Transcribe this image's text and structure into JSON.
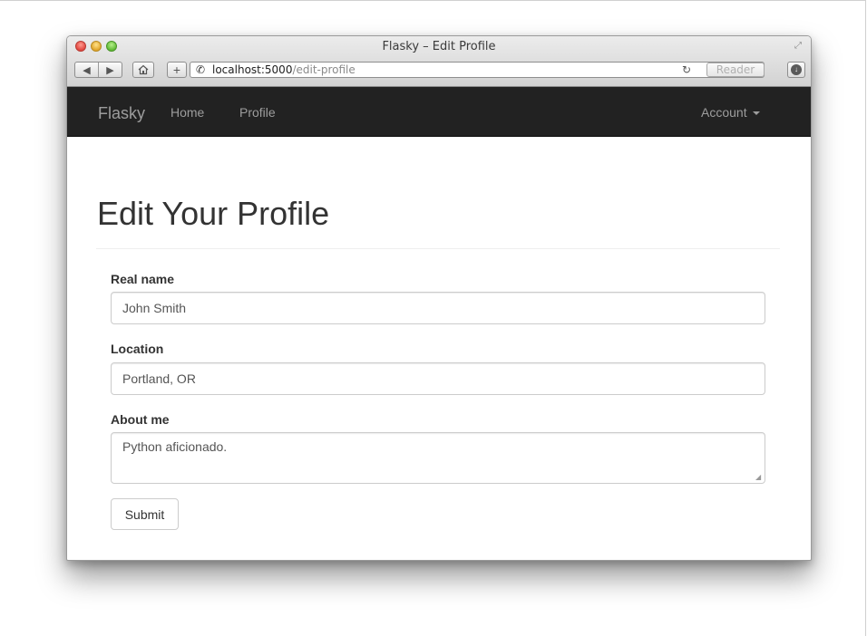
{
  "browser": {
    "window_title": "Flasky – Edit Profile",
    "url_host": "localhost:5000",
    "url_path": "/edit-profile",
    "reader_label": "Reader",
    "back_icon": "back-arrow-icon",
    "forward_icon": "forward-arrow-icon",
    "home_icon": "home-icon",
    "add_icon": "plus-icon",
    "site_icon": "phone-handset-icon",
    "reload_icon": "reload-icon",
    "download_icon": "downloads-icon"
  },
  "navbar": {
    "brand": "Flasky",
    "links": [
      "Home",
      "Profile"
    ],
    "account_label": "Account"
  },
  "page": {
    "title": "Edit Your Profile"
  },
  "form": {
    "real_name_label": "Real name",
    "real_name_value": "John Smith",
    "location_label": "Location",
    "location_value": "Portland, OR",
    "about_label": "About me",
    "about_value": "Python aficionado.",
    "submit_label": "Submit"
  },
  "colors": {
    "navbar_bg": "#222222",
    "navbar_text": "#9d9d9d",
    "heading_text": "#333333",
    "input_border": "#cccccc"
  }
}
